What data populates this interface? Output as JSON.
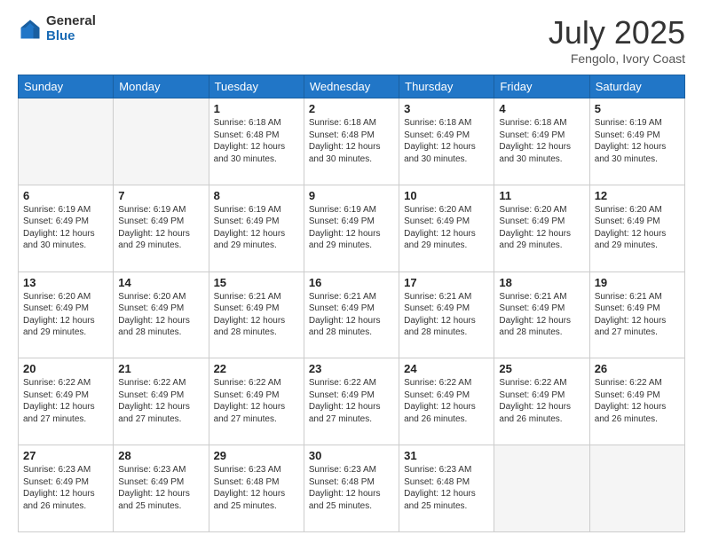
{
  "header": {
    "logo_general": "General",
    "logo_blue": "Blue",
    "title": "July 2025",
    "subtitle": "Fengolo, Ivory Coast"
  },
  "days_of_week": [
    "Sunday",
    "Monday",
    "Tuesday",
    "Wednesday",
    "Thursday",
    "Friday",
    "Saturday"
  ],
  "weeks": [
    [
      {
        "day": "",
        "info": ""
      },
      {
        "day": "",
        "info": ""
      },
      {
        "day": "1",
        "info": "Sunrise: 6:18 AM\nSunset: 6:48 PM\nDaylight: 12 hours and 30 minutes."
      },
      {
        "day": "2",
        "info": "Sunrise: 6:18 AM\nSunset: 6:48 PM\nDaylight: 12 hours and 30 minutes."
      },
      {
        "day": "3",
        "info": "Sunrise: 6:18 AM\nSunset: 6:49 PM\nDaylight: 12 hours and 30 minutes."
      },
      {
        "day": "4",
        "info": "Sunrise: 6:18 AM\nSunset: 6:49 PM\nDaylight: 12 hours and 30 minutes."
      },
      {
        "day": "5",
        "info": "Sunrise: 6:19 AM\nSunset: 6:49 PM\nDaylight: 12 hours and 30 minutes."
      }
    ],
    [
      {
        "day": "6",
        "info": "Sunrise: 6:19 AM\nSunset: 6:49 PM\nDaylight: 12 hours and 30 minutes."
      },
      {
        "day": "7",
        "info": "Sunrise: 6:19 AM\nSunset: 6:49 PM\nDaylight: 12 hours and 29 minutes."
      },
      {
        "day": "8",
        "info": "Sunrise: 6:19 AM\nSunset: 6:49 PM\nDaylight: 12 hours and 29 minutes."
      },
      {
        "day": "9",
        "info": "Sunrise: 6:19 AM\nSunset: 6:49 PM\nDaylight: 12 hours and 29 minutes."
      },
      {
        "day": "10",
        "info": "Sunrise: 6:20 AM\nSunset: 6:49 PM\nDaylight: 12 hours and 29 minutes."
      },
      {
        "day": "11",
        "info": "Sunrise: 6:20 AM\nSunset: 6:49 PM\nDaylight: 12 hours and 29 minutes."
      },
      {
        "day": "12",
        "info": "Sunrise: 6:20 AM\nSunset: 6:49 PM\nDaylight: 12 hours and 29 minutes."
      }
    ],
    [
      {
        "day": "13",
        "info": "Sunrise: 6:20 AM\nSunset: 6:49 PM\nDaylight: 12 hours and 29 minutes."
      },
      {
        "day": "14",
        "info": "Sunrise: 6:20 AM\nSunset: 6:49 PM\nDaylight: 12 hours and 28 minutes."
      },
      {
        "day": "15",
        "info": "Sunrise: 6:21 AM\nSunset: 6:49 PM\nDaylight: 12 hours and 28 minutes."
      },
      {
        "day": "16",
        "info": "Sunrise: 6:21 AM\nSunset: 6:49 PM\nDaylight: 12 hours and 28 minutes."
      },
      {
        "day": "17",
        "info": "Sunrise: 6:21 AM\nSunset: 6:49 PM\nDaylight: 12 hours and 28 minutes."
      },
      {
        "day": "18",
        "info": "Sunrise: 6:21 AM\nSunset: 6:49 PM\nDaylight: 12 hours and 28 minutes."
      },
      {
        "day": "19",
        "info": "Sunrise: 6:21 AM\nSunset: 6:49 PM\nDaylight: 12 hours and 27 minutes."
      }
    ],
    [
      {
        "day": "20",
        "info": "Sunrise: 6:22 AM\nSunset: 6:49 PM\nDaylight: 12 hours and 27 minutes."
      },
      {
        "day": "21",
        "info": "Sunrise: 6:22 AM\nSunset: 6:49 PM\nDaylight: 12 hours and 27 minutes."
      },
      {
        "day": "22",
        "info": "Sunrise: 6:22 AM\nSunset: 6:49 PM\nDaylight: 12 hours and 27 minutes."
      },
      {
        "day": "23",
        "info": "Sunrise: 6:22 AM\nSunset: 6:49 PM\nDaylight: 12 hours and 27 minutes."
      },
      {
        "day": "24",
        "info": "Sunrise: 6:22 AM\nSunset: 6:49 PM\nDaylight: 12 hours and 26 minutes."
      },
      {
        "day": "25",
        "info": "Sunrise: 6:22 AM\nSunset: 6:49 PM\nDaylight: 12 hours and 26 minutes."
      },
      {
        "day": "26",
        "info": "Sunrise: 6:22 AM\nSunset: 6:49 PM\nDaylight: 12 hours and 26 minutes."
      }
    ],
    [
      {
        "day": "27",
        "info": "Sunrise: 6:23 AM\nSunset: 6:49 PM\nDaylight: 12 hours and 26 minutes."
      },
      {
        "day": "28",
        "info": "Sunrise: 6:23 AM\nSunset: 6:49 PM\nDaylight: 12 hours and 25 minutes."
      },
      {
        "day": "29",
        "info": "Sunrise: 6:23 AM\nSunset: 6:48 PM\nDaylight: 12 hours and 25 minutes."
      },
      {
        "day": "30",
        "info": "Sunrise: 6:23 AM\nSunset: 6:48 PM\nDaylight: 12 hours and 25 minutes."
      },
      {
        "day": "31",
        "info": "Sunrise: 6:23 AM\nSunset: 6:48 PM\nDaylight: 12 hours and 25 minutes."
      },
      {
        "day": "",
        "info": ""
      },
      {
        "day": "",
        "info": ""
      }
    ]
  ]
}
